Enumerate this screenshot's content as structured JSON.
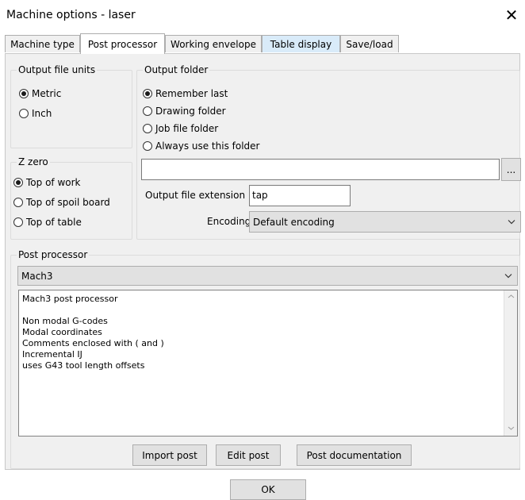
{
  "window": {
    "title": "Machine options - laser"
  },
  "tabs": [
    {
      "label": "Machine type"
    },
    {
      "label": "Post processor"
    },
    {
      "label": "Working envelope"
    },
    {
      "label": "Table display"
    },
    {
      "label": "Save/load"
    }
  ],
  "output_units": {
    "title": "Output file units",
    "options": [
      "Metric",
      "Inch"
    ],
    "selected": "Metric"
  },
  "output_folder": {
    "title": "Output folder",
    "options": [
      "Remember last",
      "Drawing folder",
      "Job file folder",
      "Always use this folder"
    ],
    "selected": "Remember last",
    "path_value": "",
    "browse_label": "...",
    "extension_label": "Output file extension",
    "extension_value": "tap",
    "encoding_label": "Encoding",
    "encoding_value": "Default encoding"
  },
  "z_zero": {
    "title": "Z zero",
    "options": [
      "Top of work",
      "Top of spoil board",
      "Top of table"
    ],
    "selected": "Top of work"
  },
  "post_processor": {
    "title": "Post processor",
    "selected": "Mach3",
    "description": [
      "Mach3 post processor",
      "",
      "Non modal G-codes",
      "Modal coordinates",
      "Comments enclosed with ( and )",
      "Incremental IJ",
      "uses G43 tool length offsets"
    ],
    "buttons": {
      "import": "Import post",
      "edit": "Edit post",
      "docs": "Post documentation"
    }
  },
  "footer": {
    "ok_label": "OK"
  }
}
